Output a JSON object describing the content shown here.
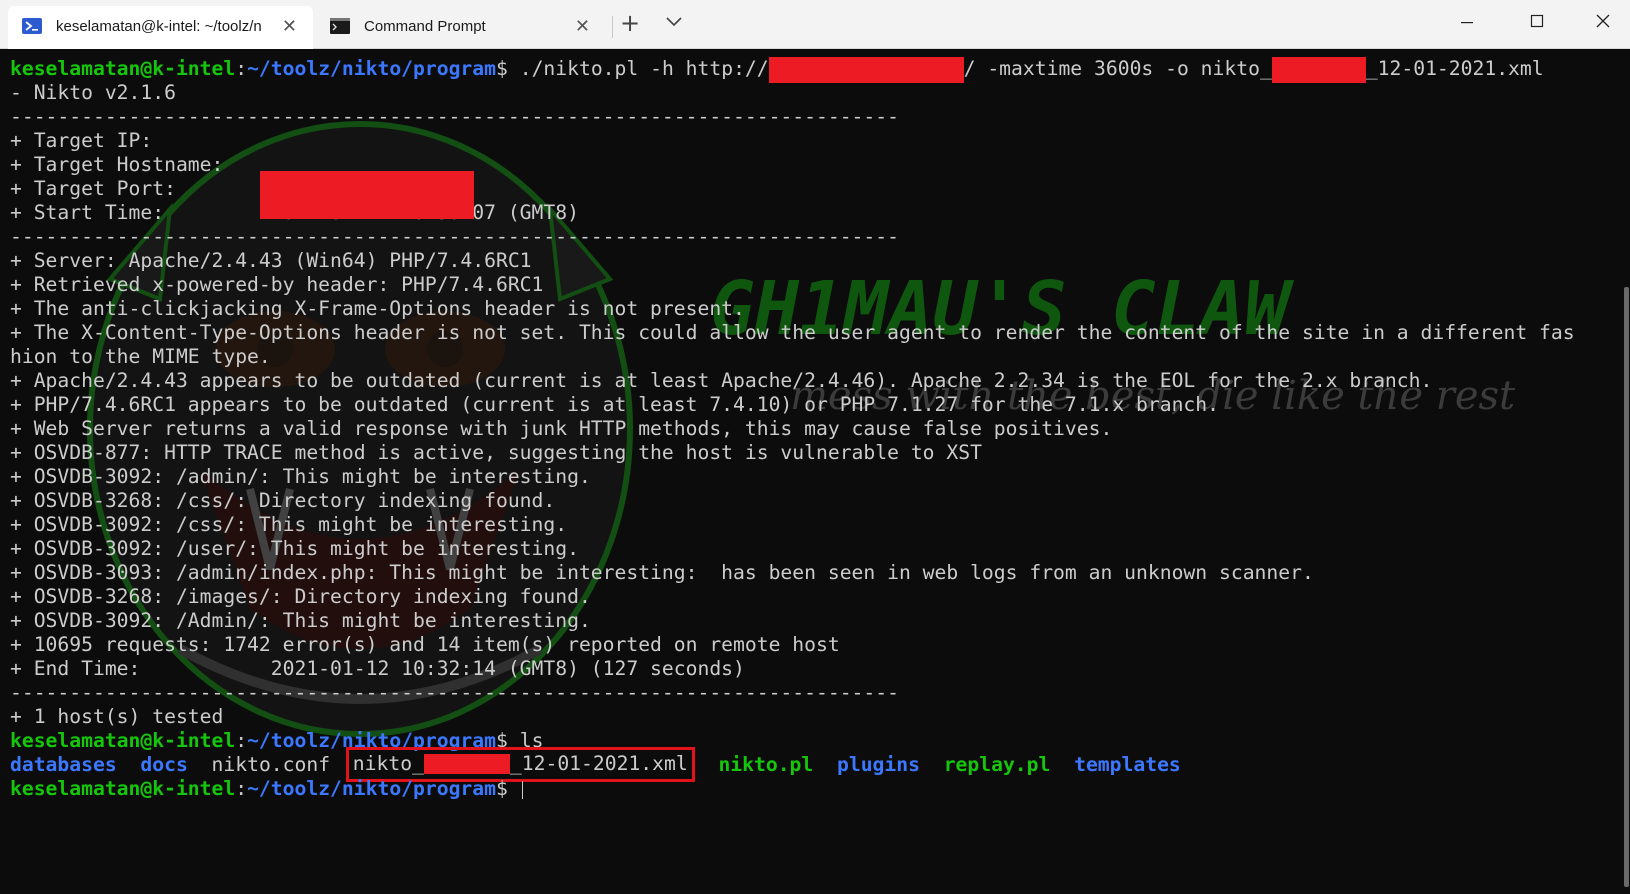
{
  "tabs": [
    {
      "label": "keselamatan@k-intel: ~/toolz/n",
      "icon": "powershell-icon",
      "active": true
    },
    {
      "label": "Command Prompt",
      "icon": "cmd-icon",
      "active": false
    }
  ],
  "titlebar": {
    "new_tab": "+",
    "close_glyph": "✕"
  },
  "colors": {
    "prompt_user": "#16c60c",
    "path": "#3b78ff",
    "text": "#cccccc",
    "background": "#0c0c0c",
    "highlight": "#e2121b",
    "redaction": "#ed1c24"
  },
  "prompt": {
    "user": "keselamatan@k-intel",
    "sep": ":",
    "path": "~/toolz/nikto/program",
    "dollar": "$"
  },
  "command1": {
    "part1": " ./nikto.pl -h http://",
    "part2": "/ -maxtime 3600s -o nikto_",
    "part3": "_12-01-2021.xml"
  },
  "output": {
    "version": "- Nikto v2.1.6",
    "divider": "---------------------------------------------------------------------------",
    "target_ip": "+ Target IP:",
    "target_hostname": "+ Target Hostname:",
    "target_port": "+ Target Port:        80",
    "start_time": "+ Start Time:         2021-01-12 10:30:07 (GMT8)",
    "results": [
      "+ Server: Apache/2.4.43 (Win64) PHP/7.4.6RC1",
      "+ Retrieved x-powered-by header: PHP/7.4.6RC1",
      "+ The anti-clickjacking X-Frame-Options header is not present.",
      "+ The X-Content-Type-Options header is not set. This could allow the user agent to render the content of the site in a different fas",
      "hion to the MIME type.",
      "+ Apache/2.4.43 appears to be outdated (current is at least Apache/2.4.46). Apache 2.2.34 is the EOL for the 2.x branch.",
      "+ PHP/7.4.6RC1 appears to be outdated (current is at least 7.4.10) or PHP 7.1.27 for the 7.1.x branch.",
      "+ Web Server returns a valid response with junk HTTP methods, this may cause false positives.",
      "+ OSVDB-877: HTTP TRACE method is active, suggesting the host is vulnerable to XST",
      "+ OSVDB-3092: /admin/: This might be interesting.",
      "+ OSVDB-3268: /css/: Directory indexing found.",
      "+ OSVDB-3092: /css/: This might be interesting.",
      "+ OSVDB-3092: /user/: This might be interesting.",
      "+ OSVDB-3093: /admin/index.php: This might be interesting:  has been seen in web logs from an unknown scanner.",
      "+ OSVDB-3268: /images/: Directory indexing found.",
      "+ OSVDB-3092: /Admin/: This might be interesting.",
      "+ 10695 requests: 1742 error(s) and 14 item(s) reported on remote host",
      "+ End Time:           2021-01-12 10:32:14 (GMT8) (127 seconds)"
    ],
    "hosts_tested": "+ 1 host(s) tested"
  },
  "command2": " ls",
  "ls": {
    "databases": "databases",
    "docs": "docs",
    "nikto_conf": "nikto.conf",
    "xml_prefix": "nikto_",
    "xml_suffix": "_12-01-2021.xml",
    "nikto_pl": "nikto.pl",
    "plugins": "plugins",
    "replay_pl": "replay.pl",
    "templates": "templates"
  },
  "watermark": {
    "title": "GH1MAU'S CLAW",
    "tagline": "mess with the best, die like the rest"
  }
}
